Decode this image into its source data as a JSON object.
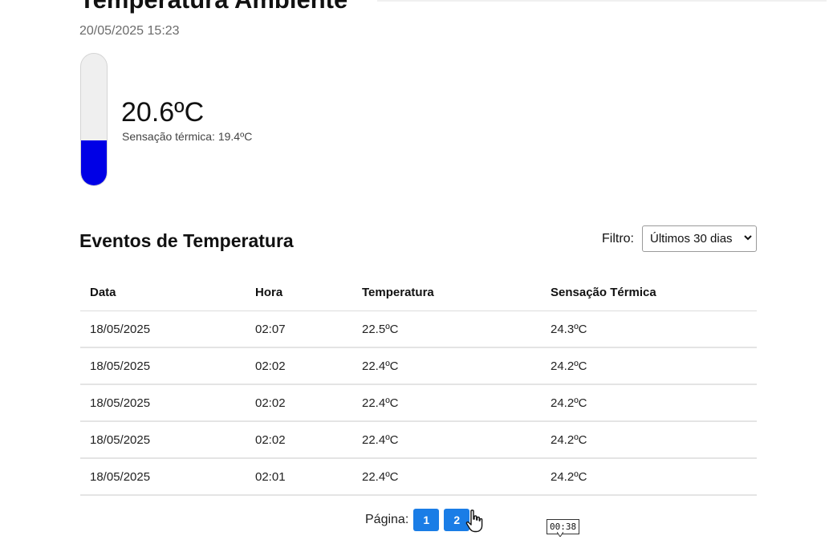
{
  "header": {
    "title": "Temperatura Ambiente",
    "timestamp": "20/05/2025 15:23"
  },
  "current": {
    "temperature": "20.6ºC",
    "feels_like": "Sensação térmica: 19.4ºC",
    "thermometer_fill_fraction": 0.34,
    "thermometer_color": "#0000e6"
  },
  "events": {
    "title": "Eventos de Temperatura",
    "filter_label": "Filtro:",
    "filter_selected": "Últimos 30 dias",
    "columns": [
      "Data",
      "Hora",
      "Temperatura",
      "Sensação Térmica"
    ],
    "rows": [
      [
        "18/05/2025",
        "02:07",
        "22.5ºC",
        "24.3ºC"
      ],
      [
        "18/05/2025",
        "02:02",
        "22.4ºC",
        "24.2ºC"
      ],
      [
        "18/05/2025",
        "02:02",
        "22.4ºC",
        "24.2ºC"
      ],
      [
        "18/05/2025",
        "02:02",
        "22.4ºC",
        "24.2ºC"
      ],
      [
        "18/05/2025",
        "02:01",
        "22.4ºC",
        "24.2ºC"
      ]
    ]
  },
  "pagination": {
    "label": "Página:",
    "pages": [
      "1",
      "2"
    ],
    "accent_color": "#1a7de6"
  },
  "overlay": {
    "time_badge": "00:38",
    "cursor_icon": "hand-pointer-icon"
  }
}
